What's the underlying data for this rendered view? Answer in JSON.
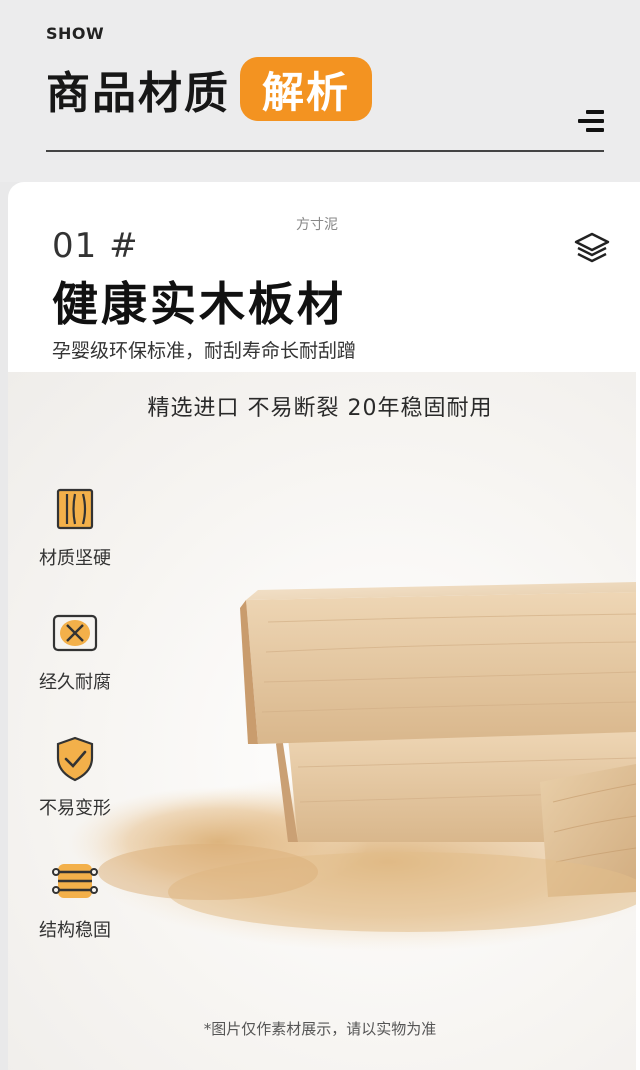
{
  "header": {
    "show_label": "SHOW",
    "title_main": "商品材质",
    "title_highlight": "解析"
  },
  "section": {
    "brand": "方寸泥",
    "number": "01 #",
    "title": "健康实木板材",
    "subtitle": "孕婴级环保标准，耐刮寿命长耐刮蹭"
  },
  "tagline": "精选进口  不易断裂  20年稳固耐用",
  "features": [
    {
      "label": "材质坚硬",
      "icon": "wood-grain-icon"
    },
    {
      "label": "经久耐腐",
      "icon": "anti-corrosion-icon"
    },
    {
      "label": "不易变形",
      "icon": "shield-check-icon"
    },
    {
      "label": "结构稳固",
      "icon": "structure-icon"
    }
  ],
  "footnote": "*图片仅作素材展示，请以实物为准",
  "colors": {
    "accent": "#f39321",
    "header_bg": "#ececed",
    "text_dark": "#171717"
  }
}
